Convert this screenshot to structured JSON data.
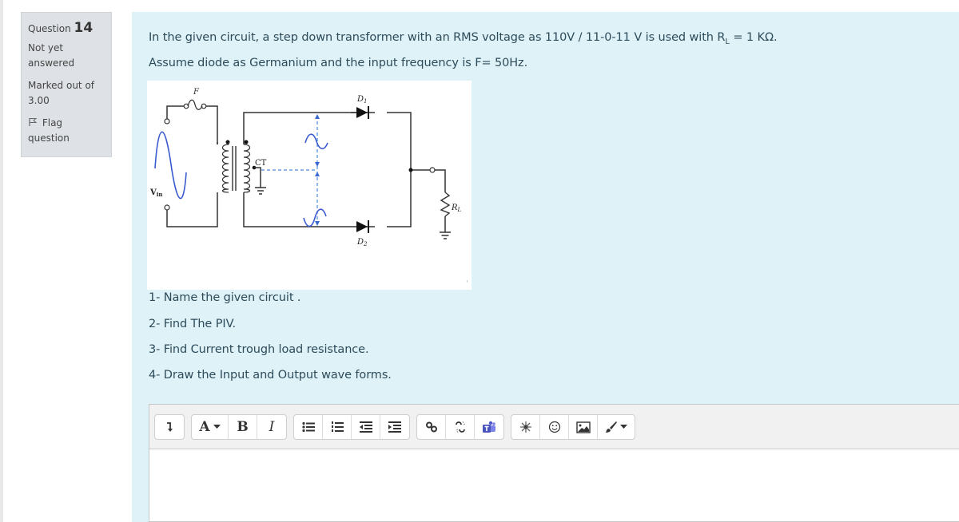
{
  "question_info": {
    "label": "Question",
    "number": "14",
    "state_line1": "Not yet",
    "state_line2": "answered",
    "marks_line1": "Marked out of",
    "marks_line2": "3.00",
    "flag_line1": "Flag",
    "flag_line2": "question"
  },
  "question": {
    "line1_prefix": "In the given circuit, a step down transformer with an RMS voltage as 110V / 11-0-11 V is used with R",
    "line1_sub": "L",
    "line1_suffix": " = 1 KΩ.",
    "line2": "Assume diode as Germanium and the input frequency is F= 50Hz.",
    "tasks": [
      "1- Name the given circuit .",
      "2- Find The PIV.",
      "3- Find Current trough load resistance.",
      "4- Draw the Input and Output wave forms."
    ]
  },
  "diagram": {
    "labels": {
      "fuse": "F",
      "vin": "V",
      "vin_sub": "in",
      "center_tap": "CT",
      "diode1": "D",
      "diode1_sub": "1",
      "diode2": "D",
      "diode2_sub": "2",
      "load": "R",
      "load_sub": "L"
    },
    "colors": {
      "wire": "#333333",
      "wave": "#3a5bd0",
      "dashed": "#4a8ee0"
    }
  },
  "editor": {
    "toolbar_groups": [
      [
        {
          "icon": "collapse-icon",
          "label": ""
        }
      ],
      [
        {
          "icon": "font-color-icon",
          "label": "A"
        },
        {
          "icon": "bold-icon",
          "label": "B"
        },
        {
          "icon": "italic-icon",
          "label": "I"
        }
      ],
      [
        {
          "icon": "unordered-list-icon"
        },
        {
          "icon": "ordered-list-icon"
        },
        {
          "icon": "outdent-icon"
        },
        {
          "icon": "indent-icon"
        }
      ],
      [
        {
          "icon": "link-icon"
        },
        {
          "icon": "unlink-icon"
        },
        {
          "icon": "teams-icon"
        }
      ],
      [
        {
          "icon": "special-character-icon"
        },
        {
          "icon": "emoji-icon"
        },
        {
          "icon": "image-icon"
        },
        {
          "icon": "brush-icon"
        }
      ]
    ],
    "answer_value": ""
  }
}
